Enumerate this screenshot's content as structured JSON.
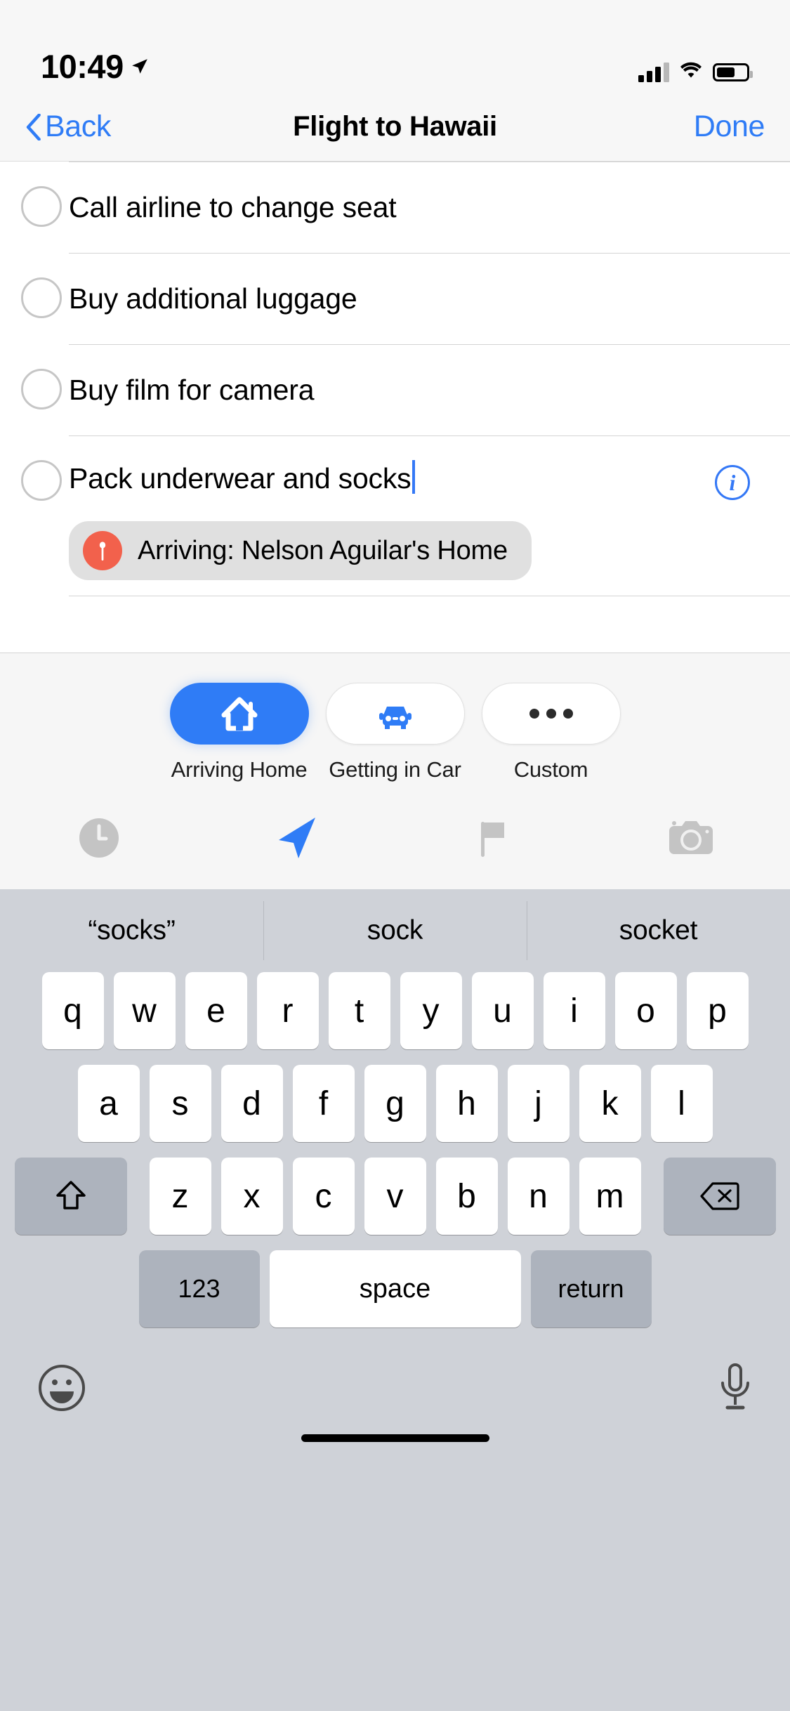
{
  "status_bar": {
    "time": "10:49",
    "location_icon": "location-arrow-icon",
    "cellular_icon": "cellular-signal-icon",
    "wifi_icon": "wifi-icon",
    "battery_icon": "battery-icon"
  },
  "nav_bar": {
    "back_label": "Back",
    "title": "Flight to Hawaii",
    "done_label": "Done"
  },
  "reminders": [
    {
      "text": "Call airline to change seat",
      "completed": false,
      "editing": false,
      "location_tag": null
    },
    {
      "text": "Buy additional luggage",
      "completed": false,
      "editing": false,
      "location_tag": null
    },
    {
      "text": "Buy film for camera",
      "completed": false,
      "editing": false,
      "location_tag": null
    },
    {
      "text": "Pack underwear and socks",
      "completed": false,
      "editing": true,
      "location_tag": "Arriving: Nelson Aguilar's Home",
      "info_label": "i"
    }
  ],
  "quick_actions": [
    {
      "label": "Arriving Home",
      "icon": "house-icon",
      "selected": true
    },
    {
      "label": "Getting in Car",
      "icon": "car-icon",
      "selected": false
    },
    {
      "label": "Custom",
      "icon": "ellipsis-icon",
      "selected": false
    }
  ],
  "toolbar": [
    {
      "icon": "clock-icon",
      "selected": false
    },
    {
      "icon": "location-arrow-icon",
      "selected": true
    },
    {
      "icon": "flag-icon",
      "selected": false
    },
    {
      "icon": "camera-icon",
      "selected": false
    }
  ],
  "keyboard": {
    "predictions": [
      "“socks”",
      "sock",
      "socket"
    ],
    "row1": [
      "q",
      "w",
      "e",
      "r",
      "t",
      "y",
      "u",
      "i",
      "o",
      "p"
    ],
    "row2": [
      "a",
      "s",
      "d",
      "f",
      "g",
      "h",
      "j",
      "k",
      "l"
    ],
    "row3": [
      "z",
      "x",
      "c",
      "v",
      "b",
      "n",
      "m"
    ],
    "shift_icon": "shift-arrow-icon",
    "backspace_icon": "backspace-icon",
    "numbers_label": "123",
    "space_label": "space",
    "return_label": "return",
    "emoji_icon": "emoji-smiley-icon",
    "dictation_icon": "microphone-icon"
  },
  "colors": {
    "accent_blue": "#2f7cf6",
    "tint_blue": "#3478f6",
    "pin_orange": "#f2614c",
    "keyboard_bg": "#cfd2d8",
    "key_white": "#ffffff",
    "key_gray": "#adb3bd",
    "badge_gray": "#e0e0e0",
    "panel_gray": "#f6f6f6"
  }
}
